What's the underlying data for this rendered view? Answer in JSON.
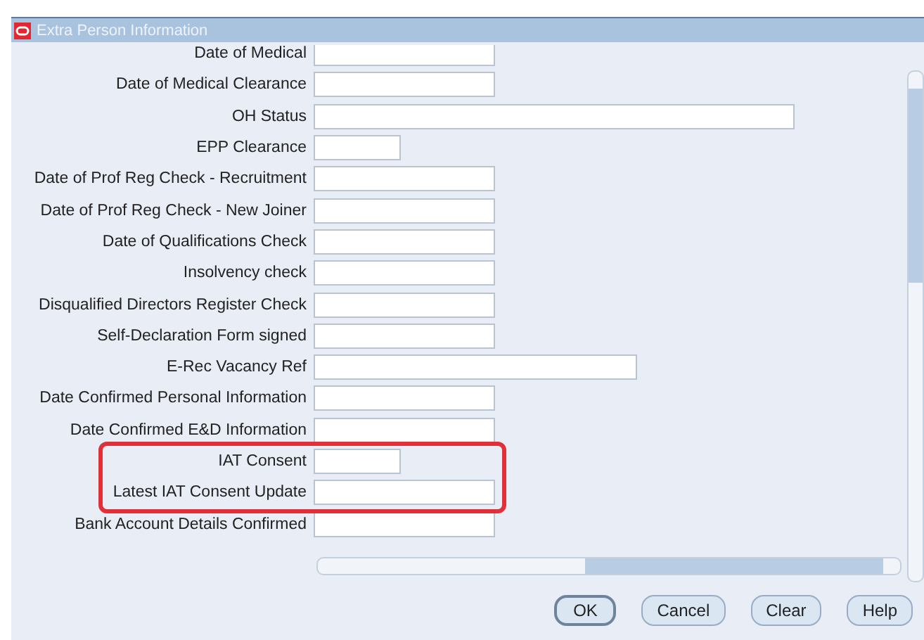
{
  "window": {
    "title": "Extra Person Information"
  },
  "fields": [
    {
      "label": "Date of Medical",
      "kind": "medium",
      "highlighted": false
    },
    {
      "label": "Date of Medical Clearance",
      "kind": "medium",
      "highlighted": false
    },
    {
      "label": "OH Status",
      "kind": "long",
      "highlighted": false
    },
    {
      "label": "EPP Clearance",
      "kind": "short",
      "highlighted": false
    },
    {
      "label": "Date of Prof Reg Check - Recruitment",
      "kind": "medium",
      "highlighted": false
    },
    {
      "label": "Date of Prof Reg Check - New Joiner",
      "kind": "medium",
      "highlighted": false
    },
    {
      "label": "Date of Qualifications Check",
      "kind": "medium",
      "highlighted": false
    },
    {
      "label": "Insolvency check",
      "kind": "medium",
      "highlighted": false
    },
    {
      "label": "Disqualified Directors Register Check",
      "kind": "medium",
      "highlighted": false
    },
    {
      "label": "Self-Declaration Form signed",
      "kind": "medium",
      "highlighted": false
    },
    {
      "label": "E-Rec Vacancy Ref",
      "kind": "wide",
      "highlighted": false
    },
    {
      "label": "Date Confirmed Personal Information",
      "kind": "medium",
      "highlighted": false
    },
    {
      "label": "Date Confirmed E&D Information",
      "kind": "medium",
      "highlighted": false
    },
    {
      "label": "IAT Consent",
      "kind": "short",
      "highlighted": true
    },
    {
      "label": "Latest IAT Consent Update",
      "kind": "medium",
      "highlighted": true
    },
    {
      "label": "Bank Account Details Confirmed",
      "kind": "medium",
      "highlighted": false
    }
  ],
  "buttons": [
    {
      "label": "OK",
      "default": true
    },
    {
      "label": "Cancel",
      "default": false
    },
    {
      "label": "Clear",
      "default": false
    },
    {
      "label": "Help",
      "default": false
    }
  ]
}
